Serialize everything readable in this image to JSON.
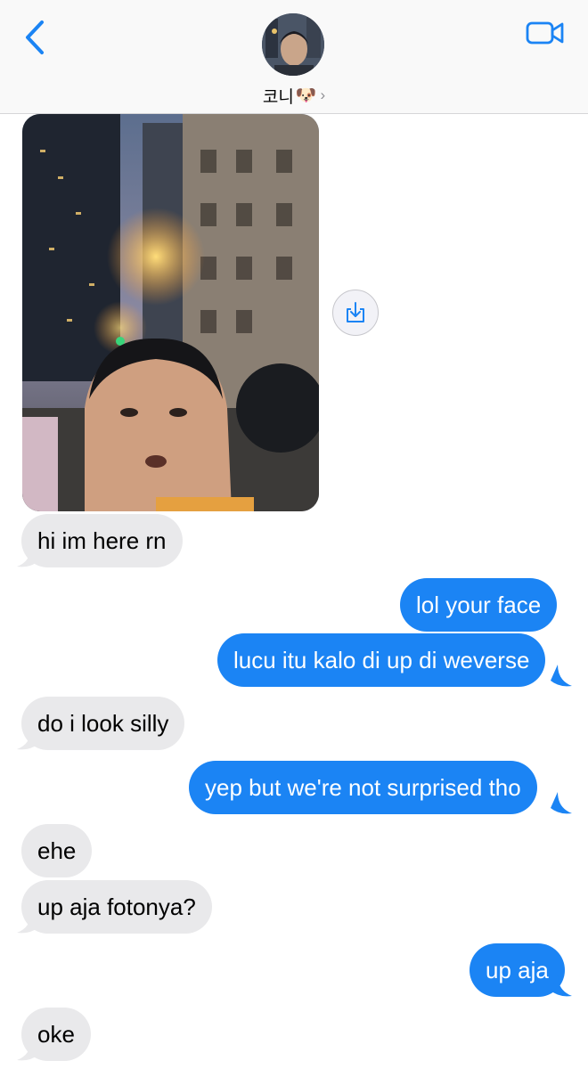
{
  "header": {
    "contact_name": "코니",
    "contact_emoji": "🐶",
    "chevron": "›",
    "back_icon": "chevron-left-icon",
    "video_icon": "video-camera-icon"
  },
  "colors": {
    "accent": "#1b84f4",
    "received_bubble": "#e9e9eb",
    "header_bg": "#f9f9f9"
  },
  "messages": [
    {
      "from": "them",
      "type": "image",
      "description": ""
    },
    {
      "from": "them",
      "text": "hi im here rn"
    },
    {
      "from": "me",
      "text": "lol your face"
    },
    {
      "from": "me",
      "text": "lucu itu kalo di up di weverse"
    },
    {
      "from": "them",
      "text": "do i look silly"
    },
    {
      "from": "me",
      "text": "yep but we're not surprised tho"
    },
    {
      "from": "them",
      "text": "ehe"
    },
    {
      "from": "them",
      "text": "up aja fotonya?"
    },
    {
      "from": "me",
      "text": "up aja"
    },
    {
      "from": "them",
      "text": "oke"
    }
  ]
}
